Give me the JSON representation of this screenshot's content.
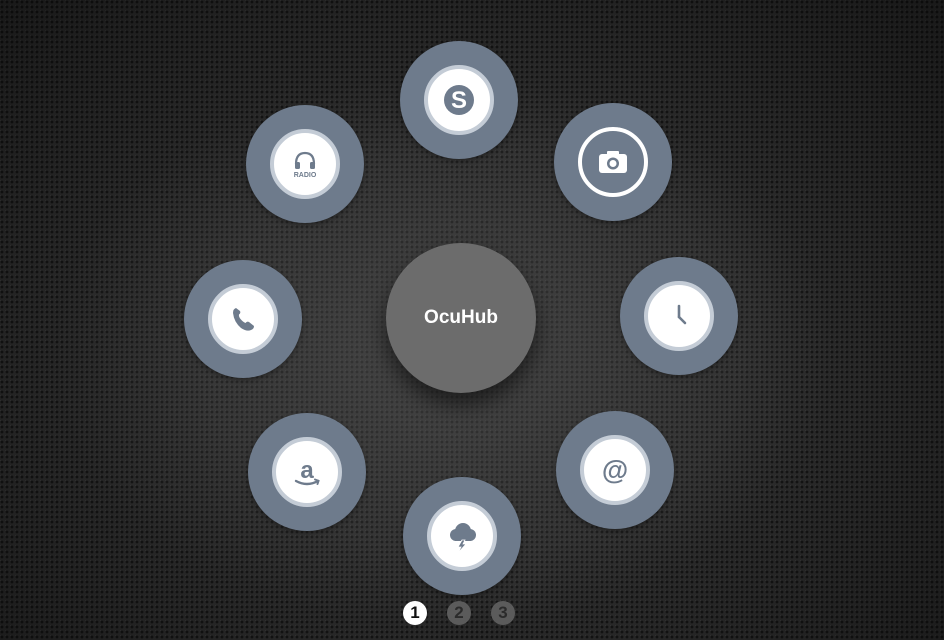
{
  "hub": {
    "label": "OcuHub"
  },
  "apps": [
    {
      "name": "skype",
      "icon": "skype-icon"
    },
    {
      "name": "camera",
      "icon": "camera-icon"
    },
    {
      "name": "clock",
      "icon": "clock-icon"
    },
    {
      "name": "email",
      "icon": "at-sign-icon"
    },
    {
      "name": "weather",
      "icon": "storm-cloud-icon"
    },
    {
      "name": "amazon",
      "icon": "amazon-icon"
    },
    {
      "name": "phone",
      "icon": "phone-icon"
    },
    {
      "name": "radio",
      "icon": "headphones-radio-icon",
      "label": "RADIO"
    }
  ],
  "pager": {
    "pages": [
      "1",
      "2",
      "3"
    ],
    "active": "1"
  },
  "colors": {
    "button_bg": "#6e7b8c",
    "icon_ring": "#c4ccd6",
    "icon_glyph": "#6e7b8c",
    "hub_bg": "#6c6c6c",
    "page_active": "#ffffff",
    "page_inactive": "#5b5b5b"
  }
}
